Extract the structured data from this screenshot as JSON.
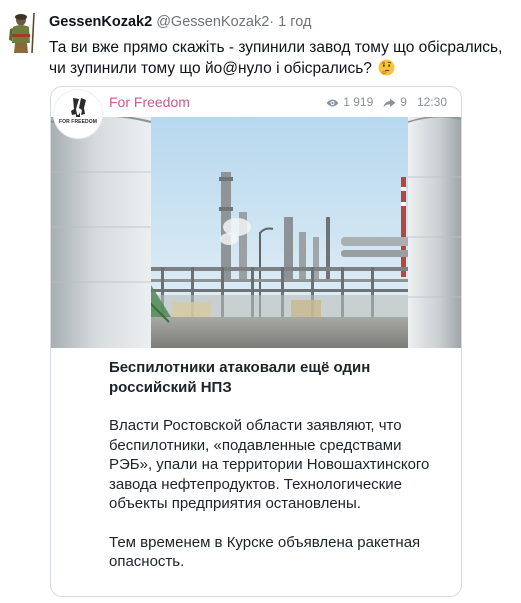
{
  "tweet": {
    "author_name": "GessenKozak2",
    "author_handle": "@GessenKozak2",
    "separator": "·",
    "time": "1 год",
    "text": "Та ви вже прямо скажіть - зупинили завод тому що обісрались, чи зупинили тому що йо@нуло і обісрались?",
    "emoji": "thinking-face"
  },
  "card": {
    "channel_name": "For Freedom",
    "logo_text": "FOR FREEDOM",
    "views": "1 919",
    "shares": "9",
    "time": "12:30",
    "post_title": "Беспилотники атаковали ещё один российский НПЗ",
    "paragraph_1": "Власти Ростовской области заявляют, что беспилотники, «подавленные средствами РЭБ», упали на территории Новошахтинского завода нефтепродуктов. Технологические объекты предприятия остановлены.",
    "paragraph_2": "Тем временем в Курске объявлена ракетная опасность."
  },
  "colors": {
    "channel_name": "#c85a8f",
    "muted": "#6d7378",
    "border": "#d6dce1",
    "emoji": "#f6c33a"
  }
}
